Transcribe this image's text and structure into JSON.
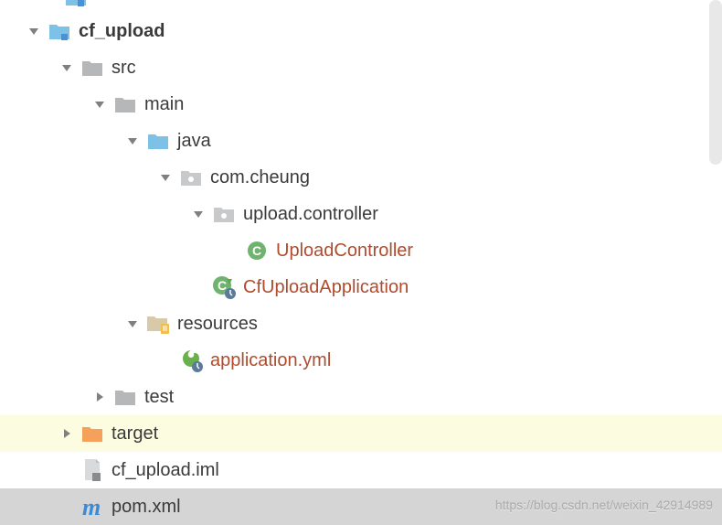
{
  "tree": {
    "project": "cf_upload",
    "src": "src",
    "main": "main",
    "java": "java",
    "package_root": "com.cheung",
    "package_ctrl": "upload.controller",
    "class_upload_controller": "UploadController",
    "class_app": "CfUploadApplication",
    "resources": "resources",
    "app_yml": "application.yml",
    "test": "test",
    "target": "target",
    "iml": "cf_upload.iml",
    "pom": "pom.xml"
  },
  "watermark": "https://blog.csdn.net/weixin_42914989"
}
